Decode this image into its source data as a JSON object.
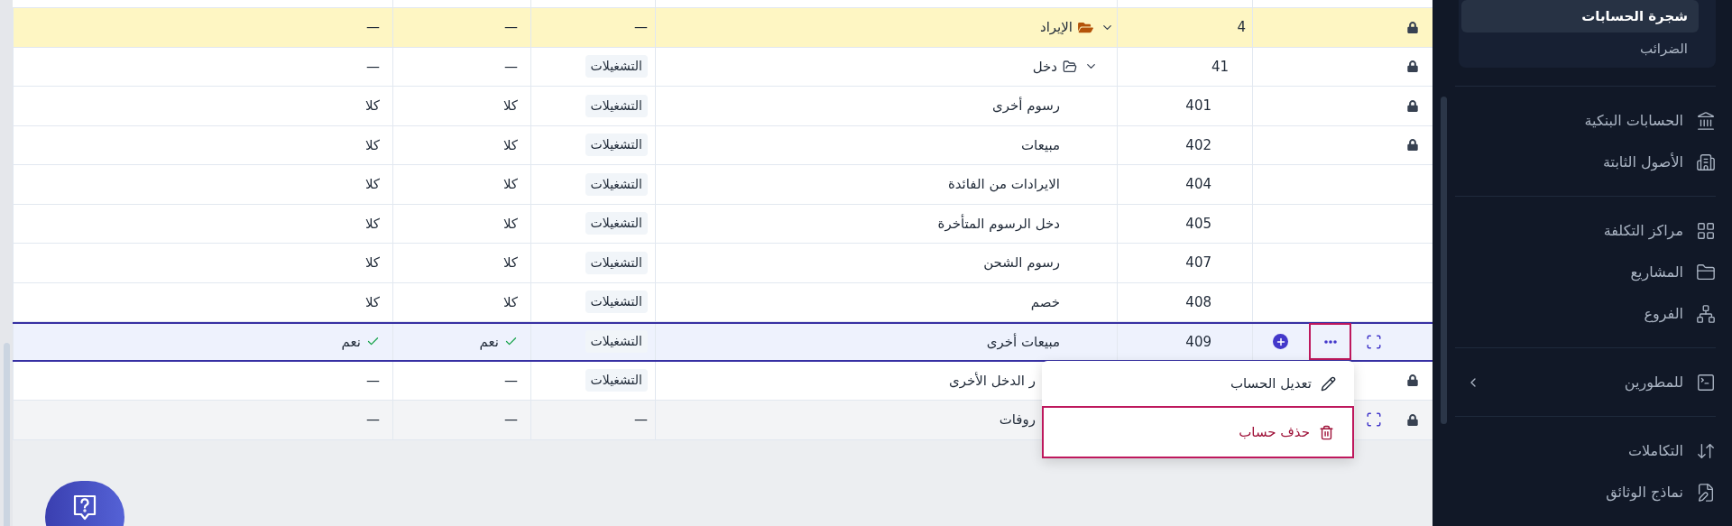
{
  "table": {
    "rows": [
      {
        "kind": "root",
        "code": "4",
        "name": "الإيراد",
        "locked": true,
        "expanded": true,
        "color": "#fef6c3",
        "selected": false,
        "type": {
          "text": "—",
          "badge": false
        },
        "column_5": {
          "text": "—",
          "checked": false
        },
        "column_6": {
          "text": "—",
          "checked": false
        },
        "children": [
          {
            "kind": "group",
            "code": "41",
            "name": "دخل",
            "locked": true,
            "expanded": true,
            "selected": false,
            "type": {
              "text": "التشغيلات",
              "badge": true
            },
            "column_5": {
              "text": "—",
              "checked": false
            },
            "column_6": {
              "text": "—",
              "checked": false
            },
            "children": [
              {
                "kind": "account",
                "code": "401",
                "name": "رسوم أخرى",
                "locked": true,
                "selected": false,
                "type": {
                  "text": "التشغيلات",
                  "badge": true
                },
                "column_5": {
                  "text": "كلا",
                  "checked": false
                },
                "column_6": {
                  "text": "كلا",
                  "checked": false
                }
              },
              {
                "kind": "account",
                "code": "402",
                "name": "مبيعات",
                "locked": true,
                "selected": false,
                "type": {
                  "text": "التشغيلات",
                  "badge": true
                },
                "column_5": {
                  "text": "كلا",
                  "checked": false
                },
                "column_6": {
                  "text": "كلا",
                  "checked": false
                }
              },
              {
                "kind": "account",
                "code": "404",
                "name": "الايرادات من الفائدة",
                "locked": false,
                "selected": false,
                "type": {
                  "text": "التشغيلات",
                  "badge": true
                },
                "column_5": {
                  "text": "كلا",
                  "checked": false
                },
                "column_6": {
                  "text": "كلا",
                  "checked": false
                }
              },
              {
                "kind": "account",
                "code": "405",
                "name": "دخل الرسوم المتأخرة",
                "locked": false,
                "selected": false,
                "type": {
                  "text": "التشغيلات",
                  "badge": true
                },
                "column_5": {
                  "text": "كلا",
                  "checked": false
                },
                "column_6": {
                  "text": "كلا",
                  "checked": false
                }
              },
              {
                "kind": "account",
                "code": "407",
                "name": "رسوم الشحن",
                "locked": false,
                "selected": false,
                "type": {
                  "text": "التشغيلات",
                  "badge": true
                },
                "column_5": {
                  "text": "كلا",
                  "checked": false
                },
                "column_6": {
                  "text": "كلا",
                  "checked": false
                }
              },
              {
                "kind": "account",
                "code": "408",
                "name": "خصم",
                "locked": false,
                "selected": false,
                "type": {
                  "text": "التشغيلات",
                  "badge": true
                },
                "column_5": {
                  "text": "كلا",
                  "checked": false
                },
                "column_6": {
                  "text": "كلا",
                  "checked": false
                }
              },
              {
                "kind": "account",
                "code": "409",
                "name": "مبيعات أخرى",
                "locked": false,
                "selected": true,
                "type": {
                  "text": "التشغيلات",
                  "badge": true
                },
                "column_5": {
                  "text": "نعم",
                  "checked": true
                },
                "column_6": {
                  "text": "نعم",
                  "checked": true
                },
                "actions": [
                  {
                    "kind": "expand"
                  },
                  {
                    "kind": "more",
                    "highlighted": true
                  },
                  {
                    "kind": "add"
                  }
                ]
              }
            ]
          },
          {
            "kind": "account",
            "name": "ر الدخل الأخرى",
            "locked": true,
            "selected": false,
            "type": {
              "text": "التشغيلات",
              "badge": true
            },
            "column_5": {
              "text": "—",
              "checked": false
            },
            "column_6": {
              "text": "—",
              "checked": false
            }
          }
        ]
      },
      {
        "kind": "account",
        "name": "روفات",
        "locked": true,
        "color": "#f3f4f6",
        "selected": false,
        "type": {
          "text": "—",
          "badge": false
        },
        "column_5": {
          "text": "—",
          "checked": false
        },
        "column_6": {
          "text": "—",
          "checked": false
        },
        "actions": [
          {
            "kind": "expand"
          }
        ]
      }
    ]
  },
  "row_menu": {
    "items": [
      {
        "kind": "edit",
        "label": "تعديل الحساب",
        "highlighted": false
      },
      {
        "kind": "delete",
        "label": "حذف حساب",
        "highlighted": true
      }
    ]
  },
  "sidebar": {
    "submenu": [
      {
        "label": "شجرة الحسابات",
        "selected": true
      },
      {
        "label": "الضرائب",
        "selected": false
      }
    ],
    "groups": [
      [
        {
          "label": "الحسابات البنكية"
        },
        {
          "label": "الأصول الثابتة"
        }
      ],
      [
        {
          "label": "مراكز التكلفة"
        },
        {
          "label": "المشاريع"
        },
        {
          "label": "الفروع"
        }
      ],
      [
        {
          "label": "للمطورين",
          "expanded": false
        }
      ],
      [
        {
          "label": "التكاملات"
        },
        {
          "label": "نماذج الوثائق"
        }
      ]
    ]
  }
}
